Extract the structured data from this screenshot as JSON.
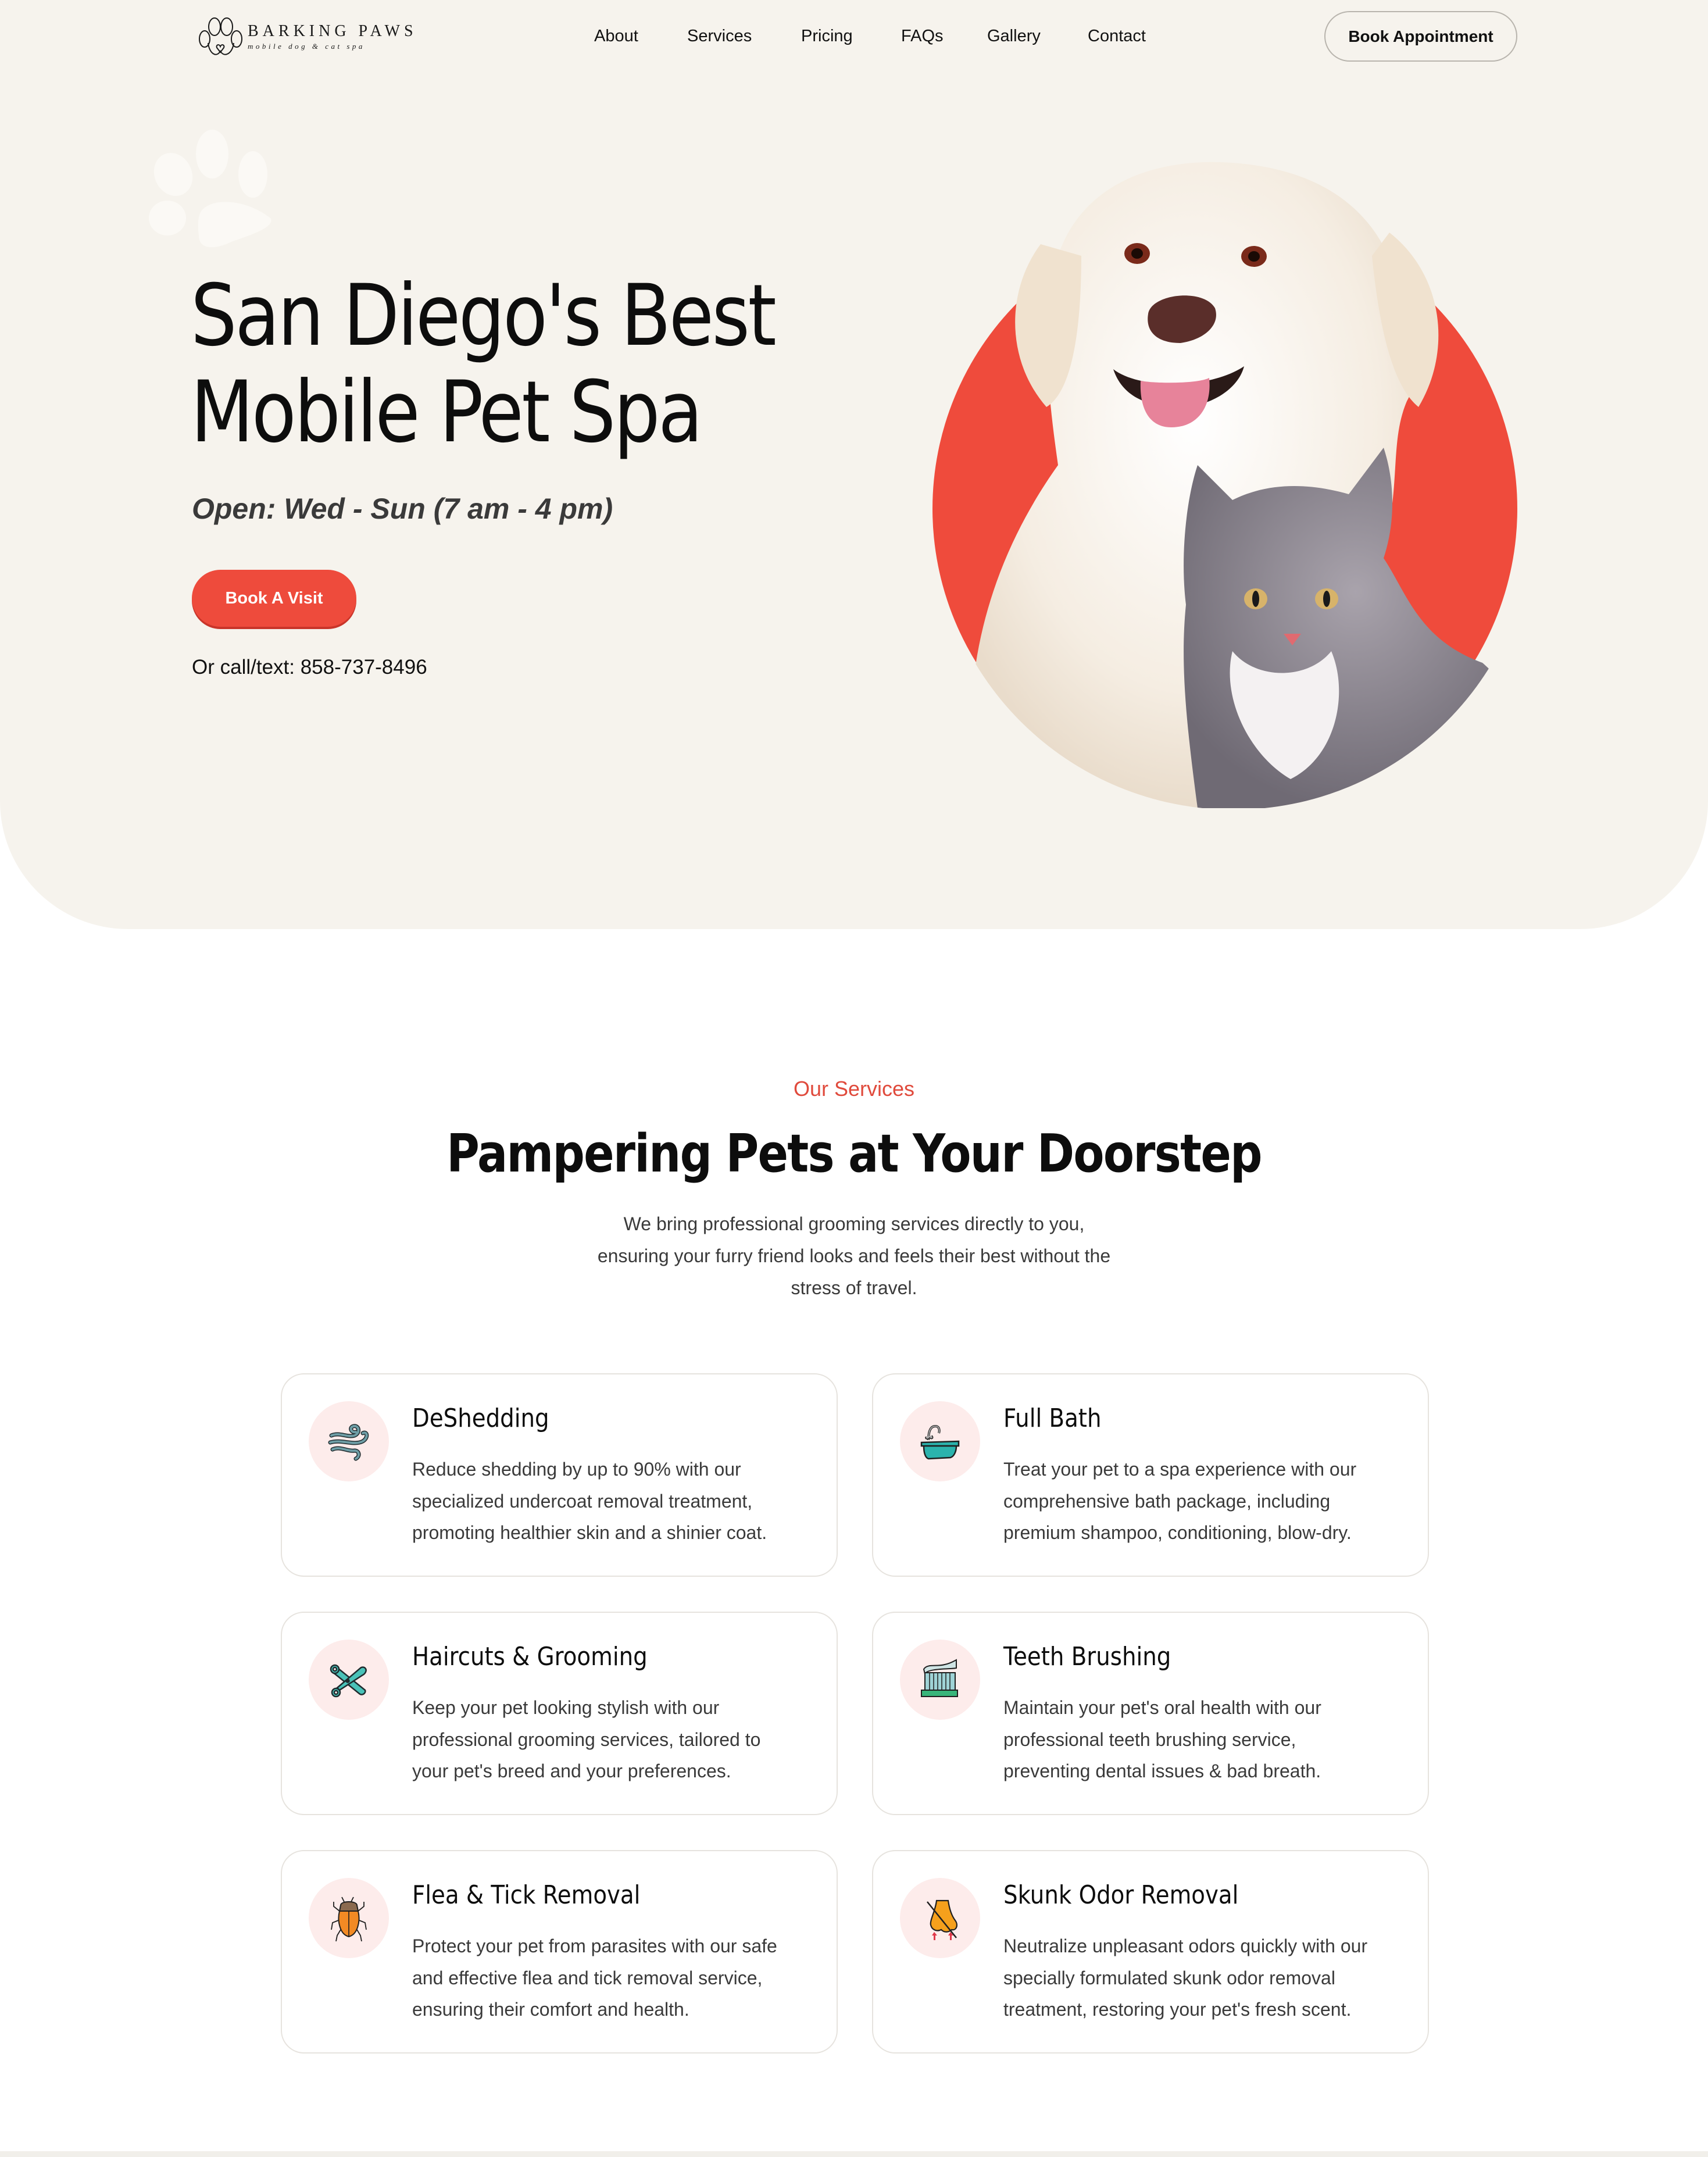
{
  "brand": {
    "name": "BARKING PAWS",
    "tagline": "mobile dog & cat spa",
    "logo_icon": "paw-heart-icon"
  },
  "nav": {
    "links": [
      {
        "label": "About"
      },
      {
        "label": "Services"
      },
      {
        "label": "Pricing"
      },
      {
        "label": "FAQs"
      },
      {
        "label": "Gallery"
      },
      {
        "label": "Contact"
      }
    ],
    "cta_label": "Book Appointment"
  },
  "hero": {
    "title_line1": "San Diego's Best",
    "title_line2": "Mobile Pet Spa",
    "hours": "Open: Wed - Sun (7 am - 4 pm)",
    "cta_label": "Book A Visit",
    "phone_text": "Or call/text: 858-737-8496",
    "image_alt": "White golden retriever and grey tabby cat",
    "decor_icon": "paw-print-icon"
  },
  "services": {
    "eyebrow": "Our Services",
    "heading": "Pampering Pets at Your Doorstep",
    "intro_line1": "We bring professional grooming services directly to you,",
    "intro_line2": "ensuring your furry friend looks and feels their best without the",
    "intro_line3": "stress of travel.",
    "items": [
      {
        "title": "DeShedding",
        "icon": "wind-icon",
        "desc_lines": [
          "Reduce shedding by up to 90% with our",
          "specialized undercoat removal treatment,",
          "promoting healthier skin and a shinier coat."
        ]
      },
      {
        "title": "Full Bath",
        "icon": "bathtub-icon",
        "desc_lines": [
          "Treat your pet to a spa experience with our",
          "comprehensive bath package, including",
          "premium shampoo, conditioning, blow-dry."
        ]
      },
      {
        "title": "Haircuts & Grooming",
        "icon": "scissors-icon",
        "desc_lines": [
          "Keep your pet looking stylish with our",
          "professional grooming services, tailored to",
          "your pet's breed and your preferences."
        ]
      },
      {
        "title": "Teeth Brushing",
        "icon": "toothbrush-icon",
        "desc_lines": [
          "Maintain your pet's oral health with our",
          "professional teeth brushing service,",
          "preventing dental issues & bad breath."
        ]
      },
      {
        "title": "Flea & Tick Removal",
        "icon": "bug-icon",
        "desc_lines": [
          "Protect your pet from parasites with our safe",
          "and effective flea and tick removal service,",
          "ensuring their comfort and health."
        ]
      },
      {
        "title": "Skunk Odor Removal",
        "icon": "no-smell-nose-icon",
        "desc_lines": [
          "Neutralize unpleasant odors quickly with our",
          "specially formulated skunk odor removal",
          "treatment, restoring your pet's fresh scent."
        ]
      }
    ]
  },
  "colors": {
    "accent": "#ee4b3c",
    "eyebrow": "#e04a3c",
    "hero_bg": "#f6f3ed",
    "icon_bg": "#fdeceb",
    "text": "#111111",
    "muted_text": "#3a3a3a"
  }
}
